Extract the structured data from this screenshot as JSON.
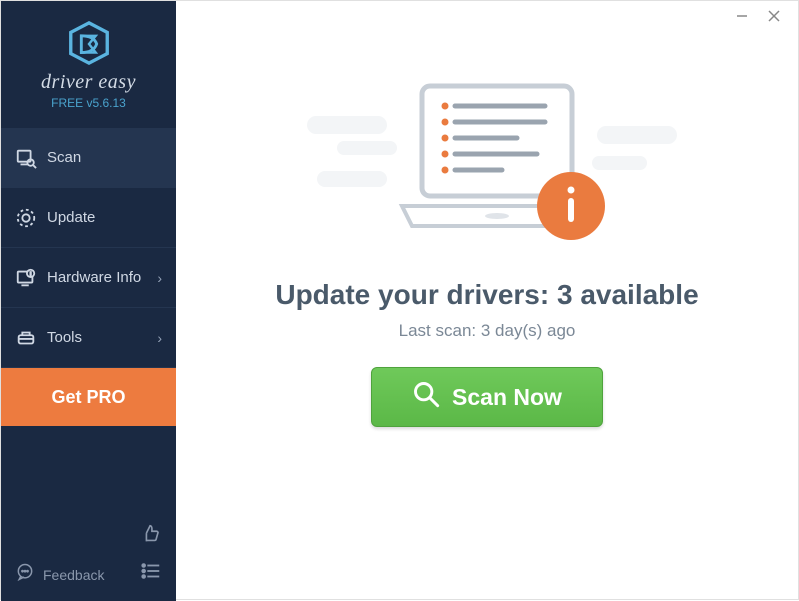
{
  "brand": {
    "name": "driver easy",
    "version": "FREE v5.6.13"
  },
  "sidebar": {
    "items": [
      {
        "label": "Scan",
        "hasSubmenu": false
      },
      {
        "label": "Update",
        "hasSubmenu": false
      },
      {
        "label": "Hardware Info",
        "hasSubmenu": true
      },
      {
        "label": "Tools",
        "hasSubmenu": true
      }
    ],
    "getPro": "Get PRO",
    "feedback": "Feedback"
  },
  "main": {
    "headline": "Update your drivers: 3 available",
    "subtext": "Last scan: 3 day(s) ago",
    "scanButton": "Scan Now"
  }
}
